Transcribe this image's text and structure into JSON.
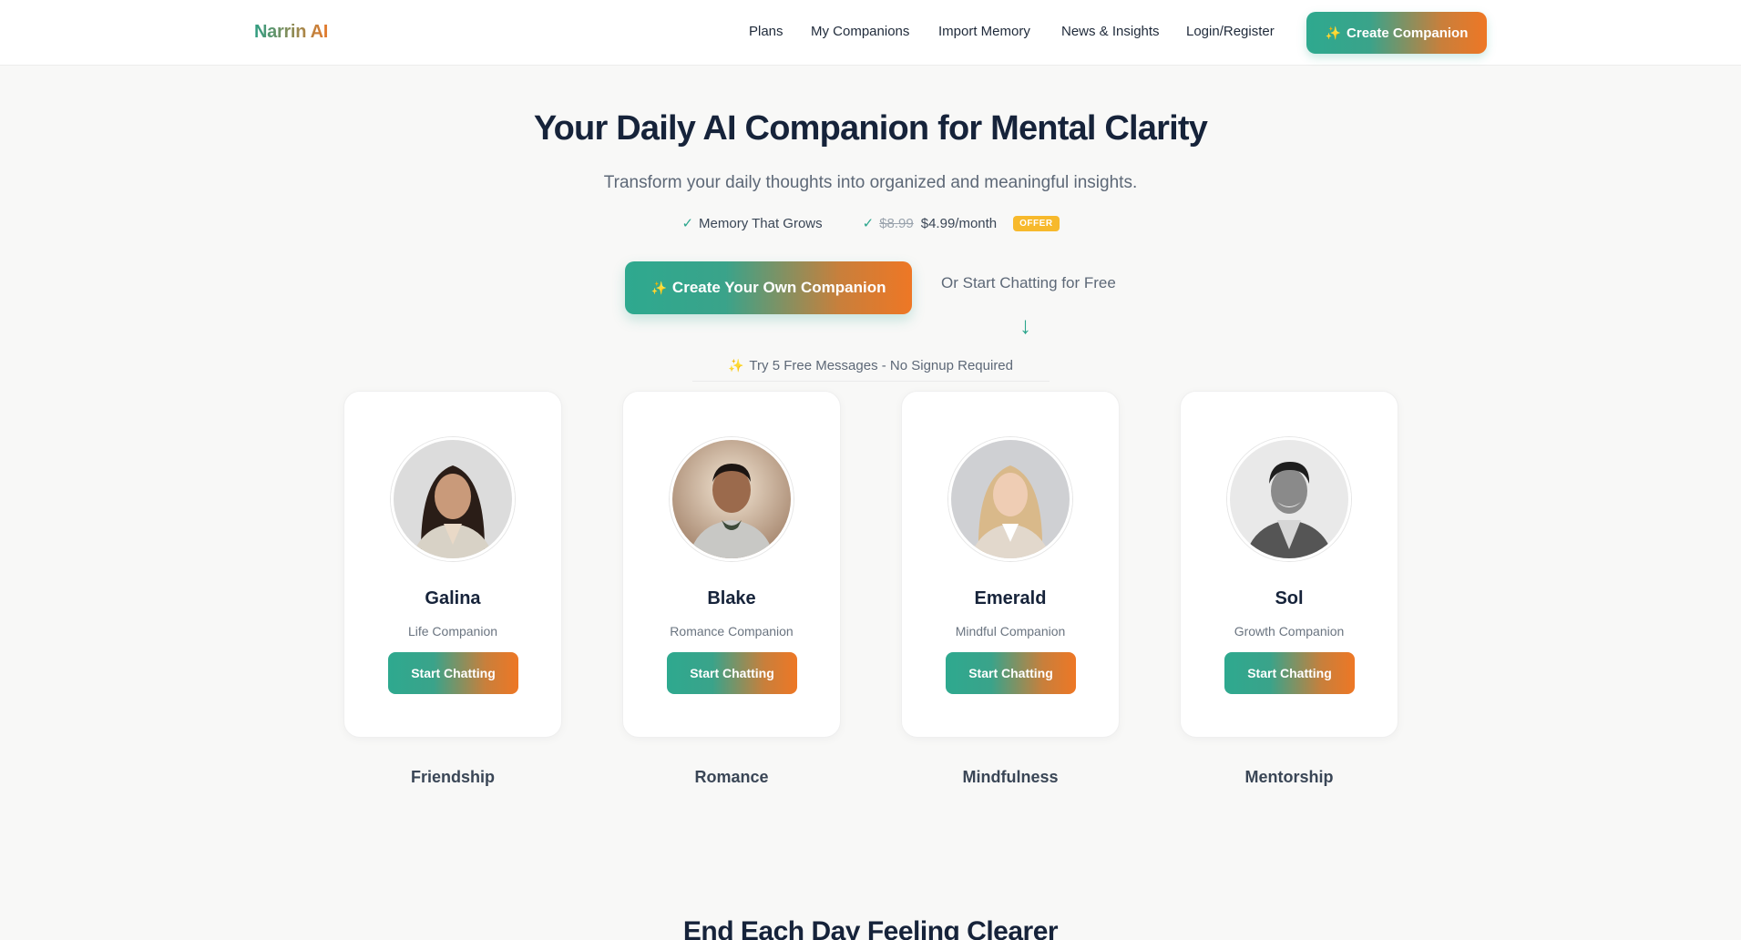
{
  "nav": {
    "logo": "Narrin AI",
    "links": [
      "Plans",
      "My Companions",
      "Import Memory",
      "News & Insights",
      "Login/Register"
    ],
    "cta": "Create Companion",
    "cta_icon": "sparkle-icon"
  },
  "hero": {
    "title": "Your Daily AI Companion for Mental Clarity",
    "subtitle": "Transform your daily thoughts into organized and meaningful insights.",
    "feature_1": "Memory That Grows",
    "price_old": "$8.99",
    "price_new": "$4.99/month",
    "offer_badge": "OFFER",
    "cta": "Create Your Own Companion",
    "alt_text": "Or Start Chatting for Free",
    "free_messages": "Try 5 Free Messages - No Signup Required"
  },
  "companions": [
    {
      "name": "Galina",
      "role": "Life Companion",
      "button": "Start Chatting",
      "category": "Friendship"
    },
    {
      "name": "Blake",
      "role": "Romance Companion",
      "button": "Start Chatting",
      "category": "Romance"
    },
    {
      "name": "Emerald",
      "role": "Mindful Companion",
      "button": "Start Chatting",
      "category": "Mindfulness"
    },
    {
      "name": "Sol",
      "role": "Growth Companion",
      "button": "Start Chatting",
      "category": "Mentorship"
    }
  ],
  "next_section": {
    "title": "End Each Day Feeling Clearer"
  },
  "colors": {
    "gradient_start": "#2ea98f",
    "gradient_end": "#ee7725",
    "check": "#2ba58c",
    "offer": "#f7b92c",
    "heading": "#16233a"
  }
}
